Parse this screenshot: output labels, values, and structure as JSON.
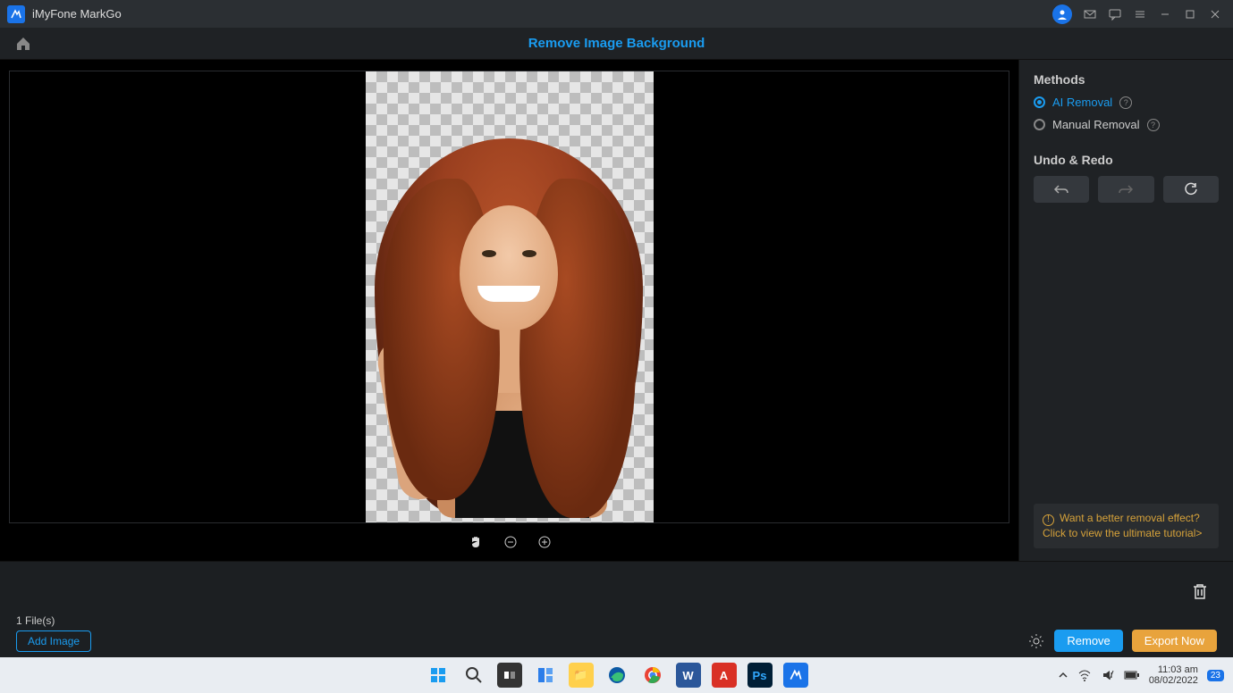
{
  "app": {
    "title": "iMyFone MarkGo"
  },
  "header": {
    "page_title": "Remove Image Background"
  },
  "panel": {
    "methods_title": "Methods",
    "methods": [
      {
        "label": "AI Removal",
        "active": true
      },
      {
        "label": "Manual Removal",
        "active": false
      }
    ],
    "undo_redo_title": "Undo & Redo",
    "tutorial_text": "Want a better removal effect? Click to view the ultimate tutorial>"
  },
  "bottom": {
    "file_count": "1 File(s)",
    "add_image": "Add Image",
    "remove": "Remove",
    "export": "Export Now"
  },
  "taskbar": {
    "time": "11:03 am",
    "date": "08/02/2022",
    "notif_count": "23"
  }
}
